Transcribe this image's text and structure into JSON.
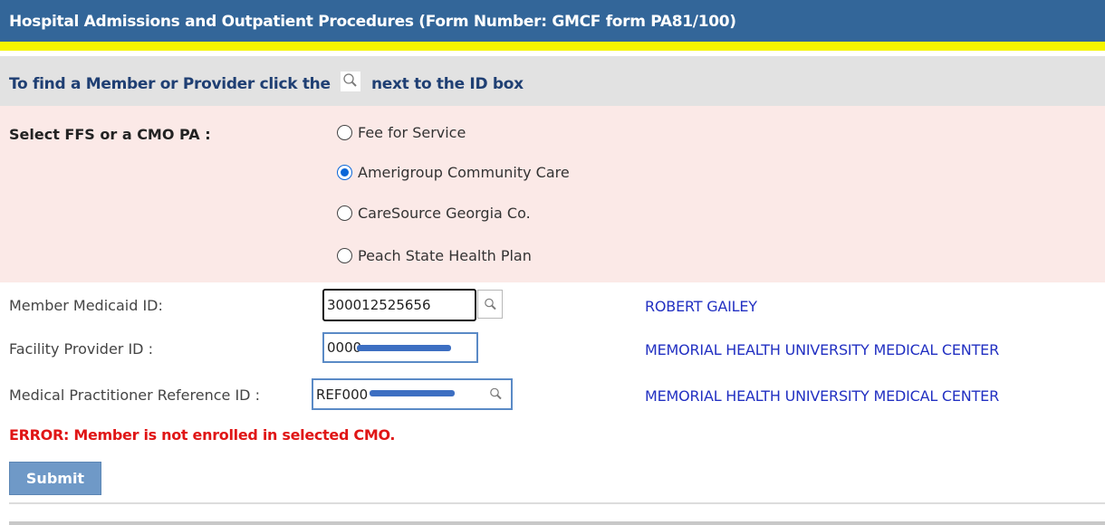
{
  "header": {
    "title": "Hospital Admissions and Outpatient Procedures (Form Number: GMCF form PA81/100)"
  },
  "info_bar": {
    "text_before": "To find a Member or Provider click the",
    "icon": "search-icon",
    "text_after": "next to the ID box"
  },
  "select_plan": {
    "label": "Select FFS or a CMO PA :",
    "options": [
      {
        "label": "Fee for Service",
        "checked": false
      },
      {
        "label": "Amerigroup Community Care",
        "checked": true
      },
      {
        "label": "CareSource Georgia Co.",
        "checked": false
      },
      {
        "label": "Peach State Health Plan",
        "checked": false
      }
    ]
  },
  "fields": {
    "member": {
      "label": "Member Medicaid ID:",
      "value": "300012525656",
      "result": "ROBERT  GAILEY"
    },
    "facility": {
      "label": "Facility Provider ID :",
      "value": "0000",
      "result": "MEMORIAL HEALTH UNIVERSITY MEDICAL CENTER"
    },
    "practitioner": {
      "label": "Medical Practitioner Reference ID :",
      "value": "REF000",
      "result": "MEMORIAL HEALTH UNIVERSITY MEDICAL CENTER"
    }
  },
  "error": {
    "text": "ERROR: Member is not enrolled in selected CMO."
  },
  "submit": {
    "label": "Submit"
  },
  "colors": {
    "header_bg": "#336699",
    "accent_yellow": "#f5f500",
    "error": "#e01616",
    "link": "#2230c2",
    "submit_bg": "#6f99c7"
  }
}
